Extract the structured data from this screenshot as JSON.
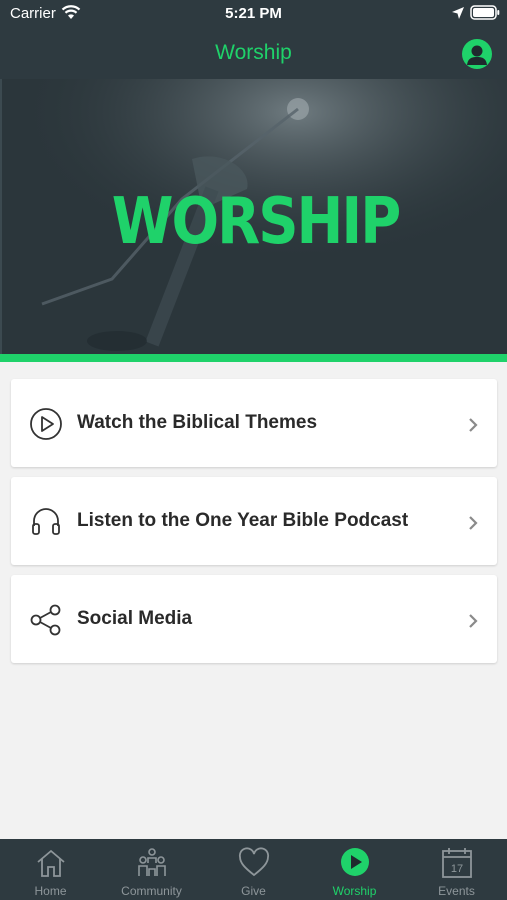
{
  "status_bar": {
    "carrier": "Carrier",
    "time": "5:21 PM"
  },
  "header": {
    "title": "Worship"
  },
  "hero": {
    "text": "WORSHIP"
  },
  "menu": [
    {
      "label": "Watch the Biblical Themes",
      "icon": "play-circle-icon"
    },
    {
      "label": "Listen to the One Year Bible Podcast",
      "icon": "headphones-icon"
    },
    {
      "label": "Social Media",
      "icon": "share-icon"
    }
  ],
  "tabs": [
    {
      "label": "Home",
      "icon": "home-icon",
      "active": false
    },
    {
      "label": "Community",
      "icon": "community-icon",
      "active": false
    },
    {
      "label": "Give",
      "icon": "heart-icon",
      "active": false
    },
    {
      "label": "Worship",
      "icon": "play-icon",
      "active": true
    },
    {
      "label": "Events",
      "icon": "calendar-icon",
      "active": false,
      "calendar_day": "17"
    }
  ],
  "colors": {
    "accent": "#1fd26a",
    "bar": "#2e3a40",
    "background": "#f2f2f2"
  }
}
